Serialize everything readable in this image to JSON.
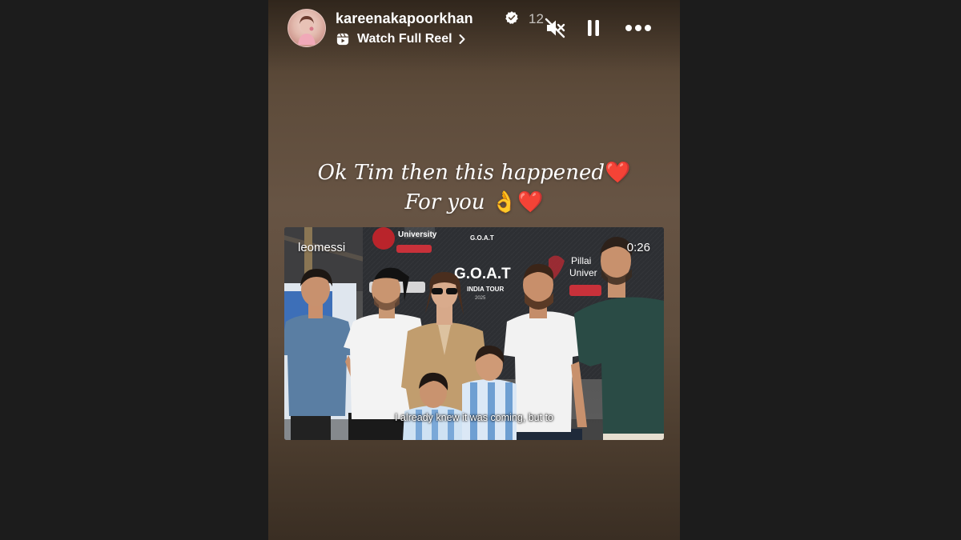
{
  "story": {
    "username": "kareenakapoorkhan",
    "time_ago": "12",
    "watch_full_reel_label": "Watch Full Reel"
  },
  "caption": {
    "line1": "Ok Tim then this happened",
    "line1_emoji": "❤️",
    "line2": "For you",
    "line2_emojis": [
      "👌",
      "❤️"
    ]
  },
  "reel": {
    "username": "leomessi",
    "duration": "0:26",
    "subtitle": "I already knew it was coming, but to",
    "banner_texts": {
      "university": "University",
      "goat": "G.O.A.T",
      "tour": "INDIA TOUR",
      "year": "2025",
      "pillai": "Pillai",
      "univer": "Univer"
    }
  },
  "icons": [
    "verified-badge-icon",
    "reels-icon",
    "chevron-right-icon",
    "mute-icon",
    "pause-icon",
    "more-options-icon"
  ],
  "colors": {
    "page_background": "#1c1c1c",
    "story_background": "#5e4c3b",
    "text": "#ffffff",
    "verified_badge": "#ffffff",
    "heart": "#e0262b"
  }
}
